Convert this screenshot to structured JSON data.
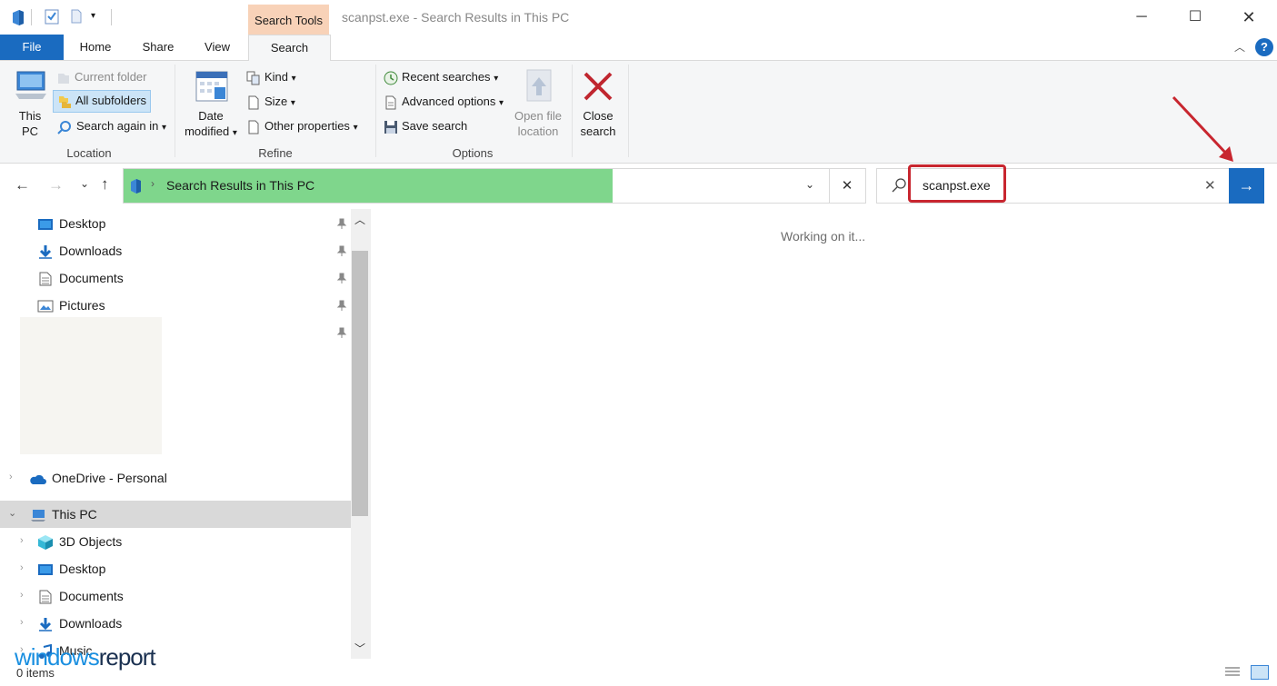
{
  "window": {
    "title": "scanpst.exe - Search Results in This PC",
    "context_tab": "Search Tools"
  },
  "tabs": [
    "File",
    "Home",
    "Share",
    "View",
    "Search"
  ],
  "ribbon": {
    "location": {
      "this_pc_line1": "This",
      "this_pc_line2": "PC",
      "current_folder": "Current folder",
      "all_subfolders": "All subfolders",
      "search_again_in": "Search again in",
      "group_label": "Location"
    },
    "refine": {
      "date_line1": "Date",
      "date_line2": "modified",
      "kind": "Kind",
      "size": "Size",
      "other_properties": "Other properties",
      "group_label": "Refine"
    },
    "options": {
      "recent_searches": "Recent searches",
      "advanced_options": "Advanced options",
      "save_search": "Save search",
      "open_file_line1": "Open file",
      "open_file_line2": "location",
      "group_label": "Options"
    },
    "close": {
      "line1": "Close",
      "line2": "search"
    }
  },
  "address": {
    "path": "Search Results in This PC"
  },
  "search": {
    "query": "scanpst.exe"
  },
  "nav": {
    "quick_access": [
      "Desktop",
      "Downloads",
      "Documents",
      "Pictures"
    ],
    "onedrive": "OneDrive - Personal",
    "this_pc": "This PC",
    "this_pc_children": [
      "3D Objects",
      "Desktop",
      "Documents",
      "Downloads",
      "Music"
    ]
  },
  "content": {
    "status_message": "Working on it..."
  },
  "statusbar": {
    "items": "0 items"
  },
  "watermark": {
    "part1": "windows",
    "part2": "report"
  },
  "colors": {
    "accent": "#1a6bc0",
    "context_tab": "#f8d2b8",
    "address_progress": "#7fd68c",
    "highlight": "#c8262f"
  }
}
